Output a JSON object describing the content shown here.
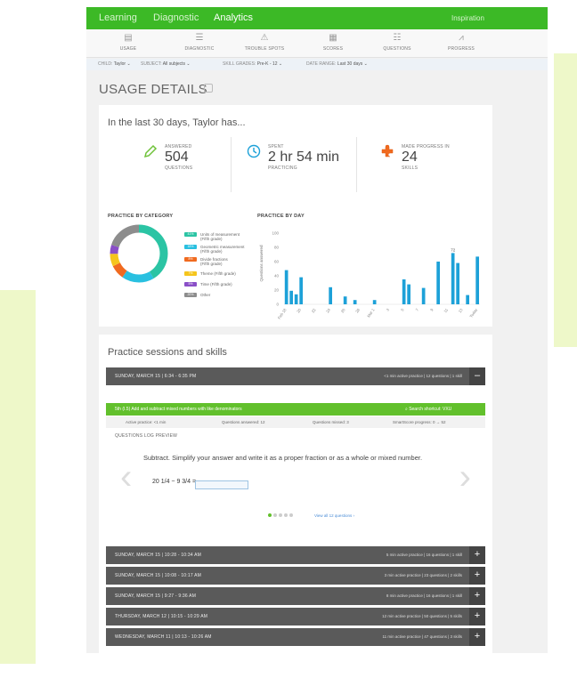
{
  "colors": {
    "brand_green": "#3cb926",
    "session_dark": "#5a5a5a",
    "bar_blue": "#1da1d8"
  },
  "topnav": {
    "learning": "Learning",
    "diagnostic": "Diagnostic",
    "analytics": "Analytics",
    "inspiration": "Inspiration"
  },
  "subnav": [
    {
      "label": "USAGE",
      "icon": "usage-icon"
    },
    {
      "label": "DIAGNOSTIC",
      "icon": "diagnostic-icon"
    },
    {
      "label": "TROUBLE SPOTS",
      "icon": "warning-icon"
    },
    {
      "label": "SCORES",
      "icon": "scores-icon"
    },
    {
      "label": "QUESTIONS",
      "icon": "questions-icon"
    },
    {
      "label": "PROGRESS",
      "icon": "progress-icon"
    }
  ],
  "filters": {
    "child_label": "CHILD:",
    "child_value": "Taylor ⌄",
    "subject_label": "SUBJECT:",
    "subject_value": "All subjects ⌄",
    "grades_label": "SKILL GRADES:",
    "grades_value": "Pre-K - 12 ⌄",
    "range_label": "DATE RANGE:",
    "range_value": "Last 30 days ⌄"
  },
  "page_title": "USAGE DETAILS",
  "summary": {
    "heading": "In the last 30 days, Taylor has...",
    "stats": [
      {
        "top": "ANSWERED",
        "value": "504",
        "bottom": "QUESTIONS",
        "icon": "pencil-icon"
      },
      {
        "top": "SPENT",
        "value": "2 hr 54 min",
        "bottom": "PRACTICING",
        "icon": "clock-icon"
      },
      {
        "top": "MADE PROGRESS IN",
        "value": "24",
        "bottom": "SKILLS",
        "icon": "puzzle-icon"
      }
    ]
  },
  "category": {
    "heading": "PRACTICE BY CATEGORY",
    "items": [
      {
        "pct": "41%",
        "label": "Units of measurement",
        "sub": "(Fifth grade)",
        "color": "#2bc4a4",
        "value": 41
      },
      {
        "pct": "18%",
        "label": "Geometric measurement",
        "sub": "(Fifth grade)",
        "color": "#29c0e0",
        "value": 18
      },
      {
        "pct": "8%",
        "label": "Divide fractions",
        "sub": "(Fifth grade)",
        "color": "#f06a1f",
        "value": 8
      },
      {
        "pct": "7%",
        "label": "Theme (Fifth grade)",
        "sub": "",
        "color": "#f5c51c",
        "value": 7
      },
      {
        "pct": "5%",
        "label": "Time (Fifth grade)",
        "sub": "",
        "color": "#8a4fc7",
        "value": 5
      },
      {
        "pct": "20%",
        "label": "Other",
        "sub": "",
        "color": "#8d8d8d",
        "value": 20
      }
    ]
  },
  "chart_data": {
    "type": "bar",
    "title": "PRACTICE BY DAY",
    "ylabel": "Questions answered",
    "ylim": [
      0,
      100
    ],
    "yticks": [
      0,
      20,
      40,
      60,
      80,
      100
    ],
    "categories": [
      "Feb 18",
      "",
      "",
      "20",
      "",
      "",
      "22",
      "",
      "",
      "24",
      "",
      "",
      "26",
      "",
      "",
      "28",
      "",
      "",
      "Mar 1",
      "",
      "",
      "3",
      "",
      "",
      "5",
      "",
      "",
      "7",
      "",
      "",
      "9",
      "",
      "",
      "11",
      "",
      "",
      "13",
      "",
      "",
      "Today"
    ],
    "values": [
      48,
      19,
      14,
      38,
      0,
      0,
      0,
      0,
      0,
      24,
      0,
      0,
      11,
      0,
      6,
      0,
      0,
      0,
      6,
      0,
      0,
      0,
      0,
      0,
      35,
      28,
      0,
      0,
      23,
      0,
      0,
      60,
      0,
      0,
      72,
      58,
      0,
      13,
      0,
      67
    ],
    "data_labels": [
      {
        "index": 34,
        "text": "72"
      }
    ],
    "grid": false
  },
  "sessions_section": {
    "heading": "Practice sessions and skills",
    "expanded": {
      "date": "SUNDAY, MARCH 15 | 6:34 - 6:35 PM",
      "meta": "<1 min active practice | 12 questions | 1 skill",
      "toggle": "–",
      "skill": "5th (I.5) Add and subtract mixed numbers with like denominators",
      "search": "⌕ Search shortcut: VXU",
      "stats": [
        "Active practice: <1 min",
        "Questions answered: 12",
        "Questions missed: 3",
        "SmartScore progress: 0 → 52"
      ],
      "log_label": "QUESTIONS LOG PREVIEW",
      "question": "Subtract. Simplify your answer and write it as a proper fraction or as a whole or mixed number.",
      "expression": "20 1/4 − 9 3/4 =",
      "view_all": "View all 12 questions ›"
    },
    "collapsed": [
      {
        "date": "SUNDAY, MARCH 15 | 10:28 - 10:34 AM",
        "meta": "5 min active practice | 16 questions | 1 skill",
        "toggle": "+"
      },
      {
        "date": "SUNDAY, MARCH 15 | 10:08 - 10:17 AM",
        "meta": "3 min active practice | 23 questions | 2 skills",
        "toggle": "+"
      },
      {
        "date": "SUNDAY, MARCH 15 | 9:27 - 9:36 AM",
        "meta": "8 min active practice | 16 questions | 1 skill",
        "toggle": "+"
      },
      {
        "date": "THURSDAY, MARCH 12 | 10:15 - 10:29 AM",
        "meta": "12 min active practice | 50 questions | 5 skills",
        "toggle": "+"
      },
      {
        "date": "WEDNESDAY, MARCH 11 | 10:13 - 10:26 AM",
        "meta": "11 min active practice | 47 questions | 3 skills",
        "toggle": "+"
      }
    ]
  }
}
